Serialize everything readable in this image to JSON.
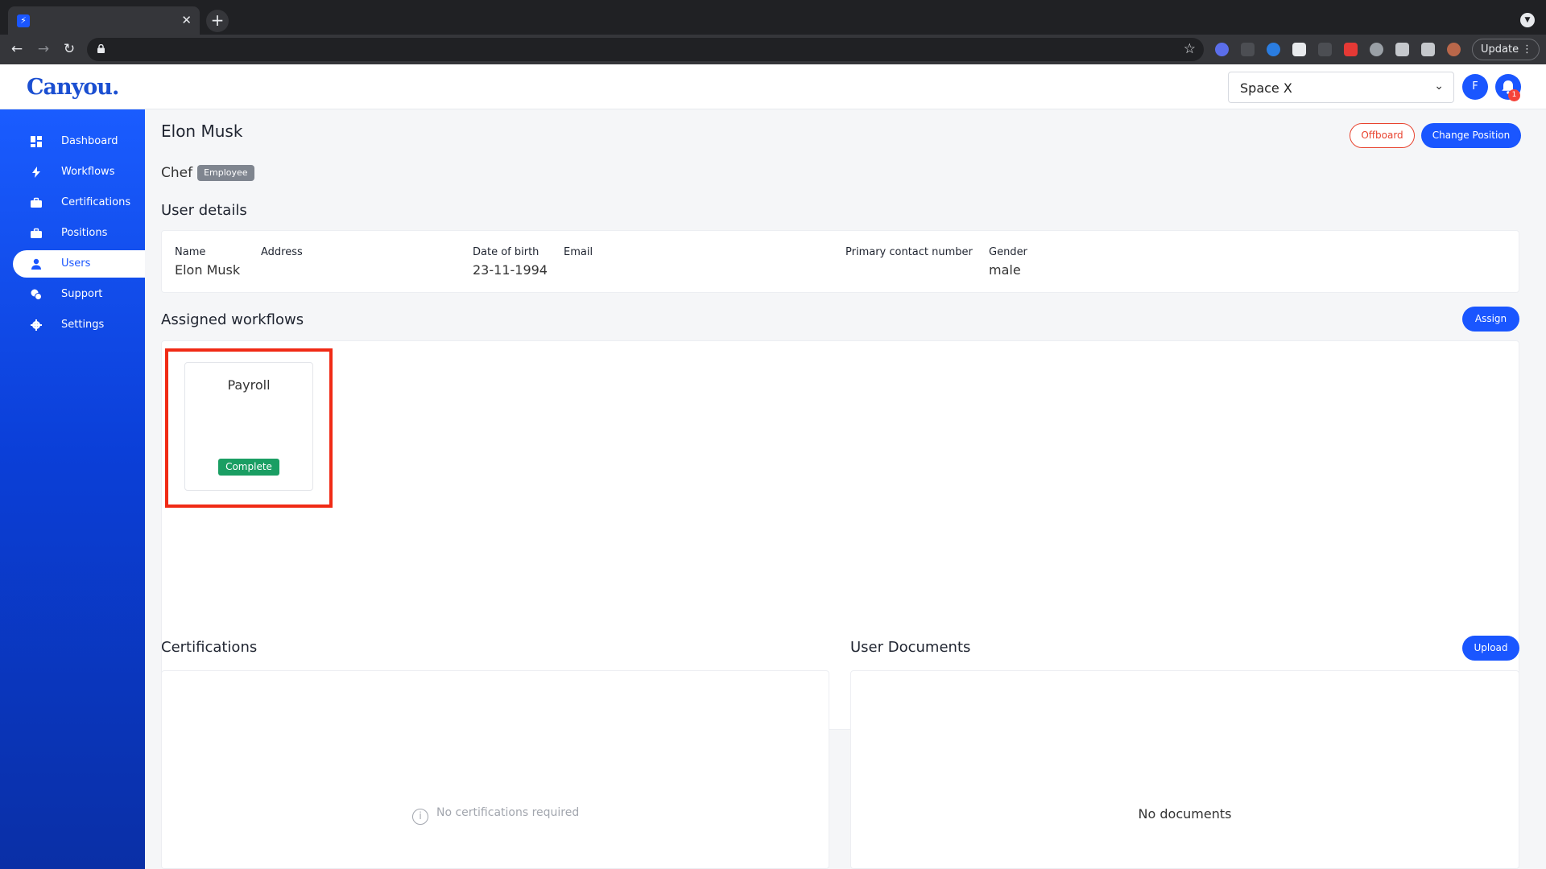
{
  "browser": {
    "tab_close": "✕",
    "new_tab": "+",
    "update_label": "Update",
    "update_menu": "⋮"
  },
  "header": {
    "logo": "Canyou.",
    "space": "Space X",
    "avatar_initial": "F",
    "notification_count": "1"
  },
  "sidebar": {
    "items": [
      {
        "label": "Dashboard",
        "icon": "dashboard-icon"
      },
      {
        "label": "Workflows",
        "icon": "lightning-icon"
      },
      {
        "label": "Certifications",
        "icon": "briefcase-icon"
      },
      {
        "label": "Positions",
        "icon": "briefcase-icon"
      },
      {
        "label": "Users",
        "icon": "user-icon",
        "active": true
      },
      {
        "label": "Support",
        "icon": "chat-icon"
      },
      {
        "label": "Settings",
        "icon": "gear-icon"
      }
    ]
  },
  "page": {
    "title": "Elon Musk",
    "offboard_label": "Offboard",
    "change_position_label": "Change Position",
    "position": "Chef",
    "role_badge": "Employee"
  },
  "user_details": {
    "heading": "User details",
    "name_label": "Name",
    "name_value": "Elon Musk",
    "address_label": "Address",
    "dob_label": "Date of birth",
    "dob_value": "23-11-1994",
    "email_label": "Email",
    "contact_label": "Primary contact number",
    "gender_label": "Gender",
    "gender_value": "male"
  },
  "workflows": {
    "heading": "Assigned workflows",
    "assign_label": "Assign",
    "items": [
      {
        "title": "Payroll",
        "status": "Complete",
        "status_color": "#1a9e63"
      }
    ]
  },
  "certifications": {
    "heading": "Certifications",
    "empty_text": "No certifications required"
  },
  "documents": {
    "heading": "User Documents",
    "upload_label": "Upload",
    "empty_text": "No documents"
  },
  "colors": {
    "primary": "#1a56ff",
    "danger": "#e8432f",
    "success": "#1a9e63"
  }
}
